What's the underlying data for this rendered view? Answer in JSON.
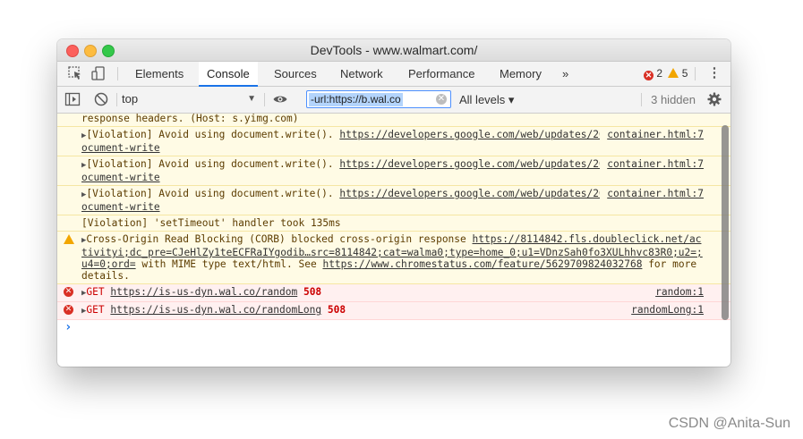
{
  "window": {
    "title": "DevTools - www.walmart.com/"
  },
  "tabs": [
    {
      "label": "Elements"
    },
    {
      "label": "Console"
    },
    {
      "label": "Sources"
    },
    {
      "label": "Network"
    },
    {
      "label": "Performance"
    },
    {
      "label": "Memory"
    },
    {
      "label": "»"
    }
  ],
  "counters": {
    "errors": "2",
    "warnings": "5"
  },
  "toolbar": {
    "context": "top",
    "filter_value": "-url:https://b.wal.co",
    "levels_label": "All levels ▾",
    "hidden_label": "3 hidden"
  },
  "console": {
    "messages": [
      {
        "type": "violation",
        "text": "response headers. (Host: s.yimg.com)"
      },
      {
        "type": "violation",
        "text": "[Violation] Avoid using document.write().",
        "link": "https://developers.google.com/web/updates/2016/08/removing-document-write",
        "source": "container.html:7"
      },
      {
        "type": "violation",
        "text": "[Violation] Avoid using document.write().",
        "link": "https://developers.google.com/web/updates/2016/08/removing-document-write",
        "source": "container.html:7"
      },
      {
        "type": "violation",
        "text": "[Violation] Avoid using document.write().",
        "link": "https://developers.google.com/web/updates/2016/08/removing-document-write",
        "source": "container.html:7"
      },
      {
        "type": "violation",
        "text": "[Violation] 'setTimeout' handler took 135ms"
      },
      {
        "type": "warning",
        "text_a": "Cross-Origin Read Blocking (CORB) blocked cross-origin response",
        "link": "https://8114842.fls.doubleclick.net/activityi;dc_pre=CJeHlZy1teECFRaIYgodib…src=8114842;cat=walma0;type=home_0;u1=VDnzSah0fo3XULhhvc83R0;u2=;u4=0;ord=",
        "text_b": "with MIME type text/html. See",
        "link2": "https://www.chromestatus.com/feature/5629709824032768",
        "text_c": "for more details."
      },
      {
        "type": "error",
        "method": "GET",
        "link": "https://is-us-dyn.wal.co/random",
        "status": "508",
        "source": "random:1"
      },
      {
        "type": "error",
        "method": "GET",
        "link": "https://is-us-dyn.wal.co/randomLong",
        "status": "508",
        "source": "randomLong:1"
      }
    ],
    "prompt": "›"
  },
  "watermark": "CSDN @Anita-Sun",
  "colors": {
    "accent": "#1a73e8",
    "error": "#d93025",
    "warning": "#f2a600",
    "violation_bg": "#fffbe5",
    "error_bg": "#fff0f0"
  }
}
